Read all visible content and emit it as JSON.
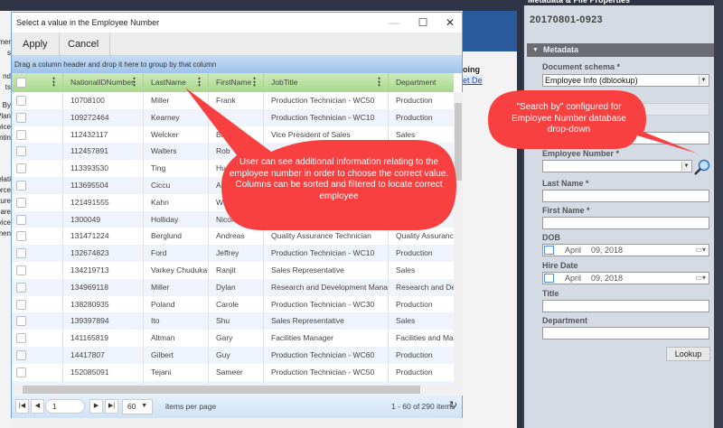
{
  "background": {
    "left_fragments": [
      "mer",
      "s",
      "nd",
      "ts",
      "d By",
      "Plan",
      "vice",
      "ntin",
      "elati",
      "orce",
      "ture",
      "are",
      "vice",
      "men"
    ],
    "mid_fragments": [
      "oing",
      "et De"
    ],
    "panel_title": "Metadata & File Properties"
  },
  "dialog": {
    "title": "Select a value in the Employee Number",
    "apply_label": "Apply",
    "cancel_label": "Cancel",
    "group_hint": "Drag a column header and drop it here to group by that column",
    "columns": [
      "NationalIDNumber",
      "LastName",
      "FirstName",
      "JobTitle",
      "Department"
    ],
    "rows": [
      [
        "10708100",
        "Miller",
        "Frank",
        "Production Technician - WC50",
        "Production"
      ],
      [
        "109272464",
        "Kearney",
        "ie",
        "Production Technician - WC10",
        "Production"
      ],
      [
        "112432117",
        "Welcker",
        "Bi",
        "Vice President of Sales",
        "Sales"
      ],
      [
        "112457891",
        "Walters",
        "Rob",
        "",
        ""
      ],
      [
        "113393530",
        "Ting",
        "Hu",
        "",
        ""
      ],
      [
        "113695504",
        "Ciccu",
        "Ali",
        "",
        ""
      ],
      [
        "121491555",
        "Kahn",
        "We",
        "",
        ""
      ],
      [
        "1300049",
        "Holliday",
        "Nicole",
        "",
        ""
      ],
      [
        "131471224",
        "Berglund",
        "Andreas",
        "Quality Assurance Technician",
        "Quality Assurance"
      ],
      [
        "132674823",
        "Ford",
        "Jeffrey",
        "Production Technician - WC10",
        "Production"
      ],
      [
        "134219713",
        "Varkey Chudukatil",
        "Ranjit",
        "Sales Representative",
        "Sales"
      ],
      [
        "134969118",
        "Miller",
        "Dylan",
        "Research and Development Manager",
        "Research and Devel"
      ],
      [
        "138280935",
        "Poland",
        "Carole",
        "Production Technician - WC30",
        "Production"
      ],
      [
        "139397894",
        "Ito",
        "Shu",
        "Sales Representative",
        "Sales"
      ],
      [
        "141165819",
        "Altman",
        "Gary",
        "Facilities Manager",
        "Facilities and Mainte"
      ],
      [
        "14417807",
        "Gilbert",
        "Guy",
        "Production Technician - WC60",
        "Production"
      ],
      [
        "152085091",
        "Tejani",
        "Sameer",
        "Production Technician - WC50",
        "Production"
      ],
      [
        "",
        "",
        "",
        "",
        ""
      ]
    ],
    "pager": {
      "page": "1",
      "page_size": "60",
      "items_per_page_label": "items per page",
      "summary": "1 - 60 of 290 items"
    }
  },
  "panel": {
    "doc_id": "20170801-0923",
    "section": "Metadata",
    "document_schema_label": "Document schema *",
    "document_schema_value": "Employee Info (dblookup)",
    "employee_number_label": "Employee Number *",
    "last_name_label": "Last Name *",
    "first_name_label": "First Name *",
    "dob_label": "DOB",
    "dob_month": "April",
    "dob_day_year": "09, 2018",
    "hire_date_label": "Hire Date",
    "hire_month": "April",
    "hire_day_year": "09, 2018",
    "title_label": "Title",
    "department_label": "Department",
    "lookup_label": "Lookup"
  },
  "callouts": {
    "grid": "User can see additional information relating to the employee number in order to choose the correct value. Columns can be sorted and filtered to locate correct employee",
    "search": "\"Search by\" configured for Employee Number database drop-down",
    "color": "#f94040"
  }
}
